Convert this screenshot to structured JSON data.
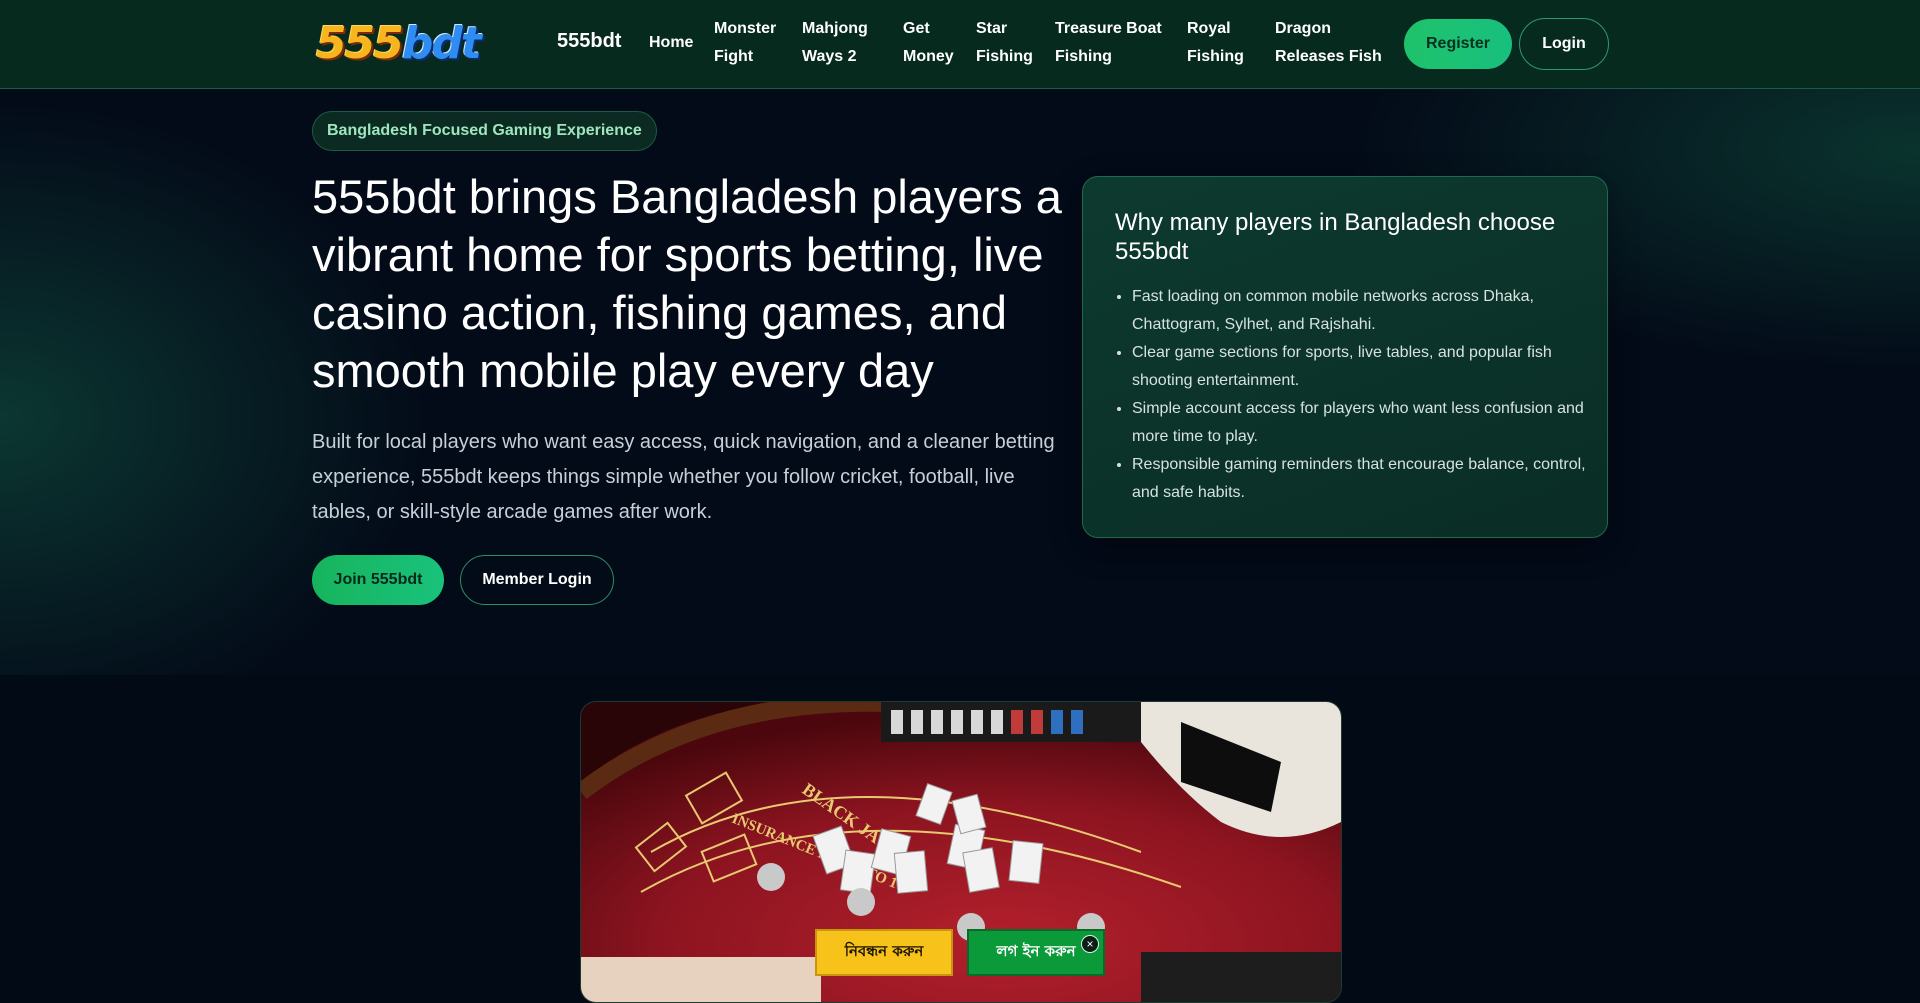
{
  "header": {
    "logo_text": "555bdt",
    "brand_name": "555bdt",
    "nav": [
      {
        "line1": "Home",
        "line2": ""
      },
      {
        "line1": "Monster",
        "line2": "Fight"
      },
      {
        "line1": "Mahjong",
        "line2": "Ways 2"
      },
      {
        "line1": "Get",
        "line2": "Money"
      },
      {
        "line1": "Star",
        "line2": "Fishing"
      },
      {
        "line1": "Treasure Boat",
        "line2": "Fishing"
      },
      {
        "line1": "Royal",
        "line2": "Fishing"
      },
      {
        "line1": "Dragon",
        "line2": "Releases Fish"
      }
    ],
    "register_label": "Register",
    "login_label": "Login"
  },
  "hero": {
    "badge": "Bangladesh Focused Gaming Experience",
    "title": "555bdt brings Bangladesh players a vibrant home for sports betting, live casino action, fishing games, and smooth mobile play every day",
    "description": "Built for local players who want easy access, quick navigation, and a cleaner betting experience, 555bdt keeps things simple whether you follow cricket, football, live tables, or skill-style arcade games after work.",
    "join_label": "Join 555bdt",
    "member_login_label": "Member Login"
  },
  "card": {
    "title": "Why many players in Bangladesh choose 555bdt",
    "items": [
      "Fast loading on common mobile networks across Dhaka, Chattogram, Sylhet, and Rajshahi.",
      "Clear game sections for sports, live tables, and popular fish shooting entertainment.",
      "Simple account access for players who want less confusion and more time to play.",
      "Responsible gaming reminders that encourage balance, control, and safe habits."
    ]
  },
  "image": {
    "table_text_1": "BLACK JACK",
    "table_text_2": "INSURANCE PAYS 2 TO 1"
  },
  "floating_bar": {
    "register_label": "নিবন্ধন করুন",
    "login_label": "লগ ইন করুন",
    "close_icon": "×"
  },
  "colors": {
    "header_bg": "#072a1f",
    "accent_green": "#1fc26b",
    "page_bg": "#030a18",
    "floating_register": "#f7c21a",
    "floating_login": "#0a9a3a"
  }
}
